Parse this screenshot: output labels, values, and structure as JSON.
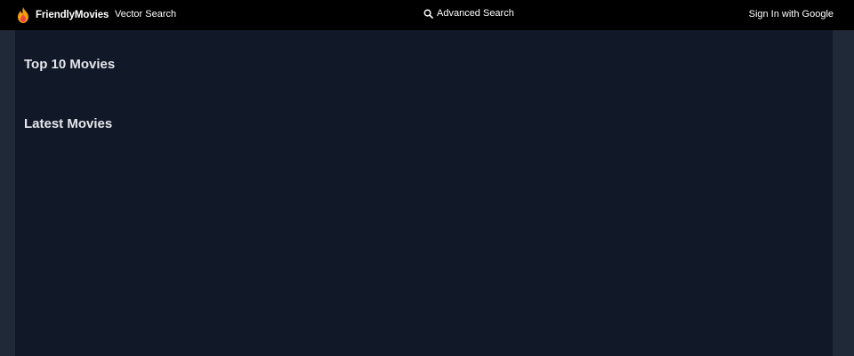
{
  "header": {
    "brand": "FriendlyMovies",
    "vector_search": "Vector Search",
    "advanced_search": "Advanced Search",
    "sign_in": "Sign In with Google"
  },
  "sections": [
    {
      "title": "Top 10 Movies"
    },
    {
      "title": "Latest Movies"
    }
  ],
  "icons": {
    "logo": "flame-icon",
    "search": "search-icon"
  },
  "colors": {
    "topbar": "#000000",
    "page_bg": "#1f2937",
    "content_bg": "#111827",
    "flame_outer": "#f59e0b",
    "flame_inner": "#ef4444"
  }
}
